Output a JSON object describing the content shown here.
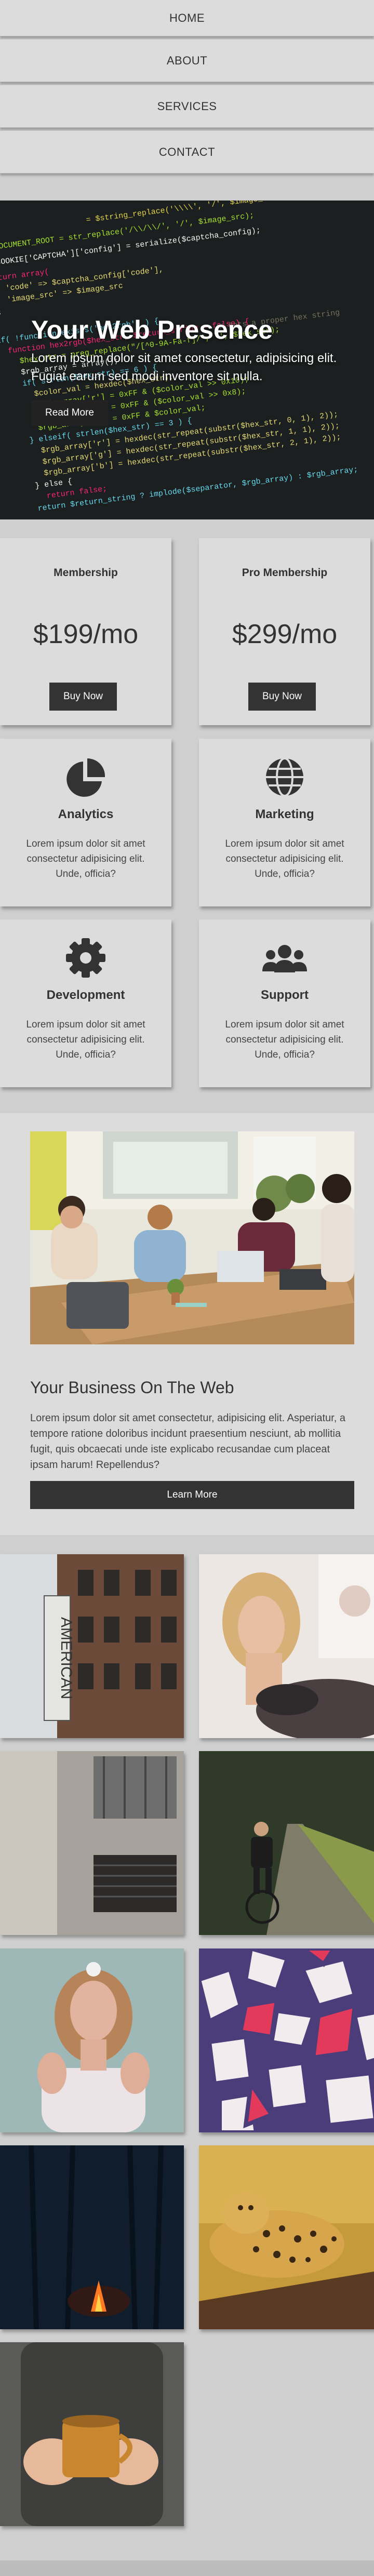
{
  "nav": {
    "items": [
      "HOME",
      "ABOUT",
      "SERVICES",
      "CONTACT"
    ]
  },
  "hero": {
    "title": "Your Web Presence",
    "subtitle": "Lorem ipsum dolor sit amet consectetur, adipisicing elit. Fugiat earum sed modi inventore sit nulla.",
    "button": "Read More"
  },
  "pricing": [
    {
      "title": "Membership",
      "price": "$199/mo",
      "button": "Buy Now"
    },
    {
      "title": "Pro Membership",
      "price": "$299/mo",
      "button": "Buy Now"
    }
  ],
  "features": [
    {
      "title": "Analytics",
      "desc": "Lorem ipsum dolor sit amet consectetur adipisicing elit. Unde, officia?",
      "icon": "pie-chart-icon"
    },
    {
      "title": "Marketing",
      "desc": "Lorem ipsum dolor sit amet consectetur adipisicing elit. Unde, officia?",
      "icon": "globe-icon"
    },
    {
      "title": "Development",
      "desc": "Lorem ipsum dolor sit amet consectetur adipisicing elit. Unde, officia?",
      "icon": "gear-icon"
    },
    {
      "title": "Support",
      "desc": "Lorem ipsum dolor sit amet consectetur adipisicing elit. Unde, officia?",
      "icon": "users-icon"
    }
  ],
  "business": {
    "title": "Your Business On The Web",
    "desc": "Lorem ipsum dolor sit amet consectetur, adipisicing elit. Asperiatur, a tempore ratione doloribus incidunt praesentium nesciunt, ab mollitia fugit, quis obcaecati unde iste explicabo recusandae cum placeat ipsam harum! Repellendus?",
    "button": "Learn More",
    "sign_text": "AMERICAN"
  },
  "colors": {
    "page_bg": "#cfcfcf",
    "card_bg": "#dcdcdc",
    "button_bg": "#333333",
    "hero_bg": "#1c1f1f"
  }
}
